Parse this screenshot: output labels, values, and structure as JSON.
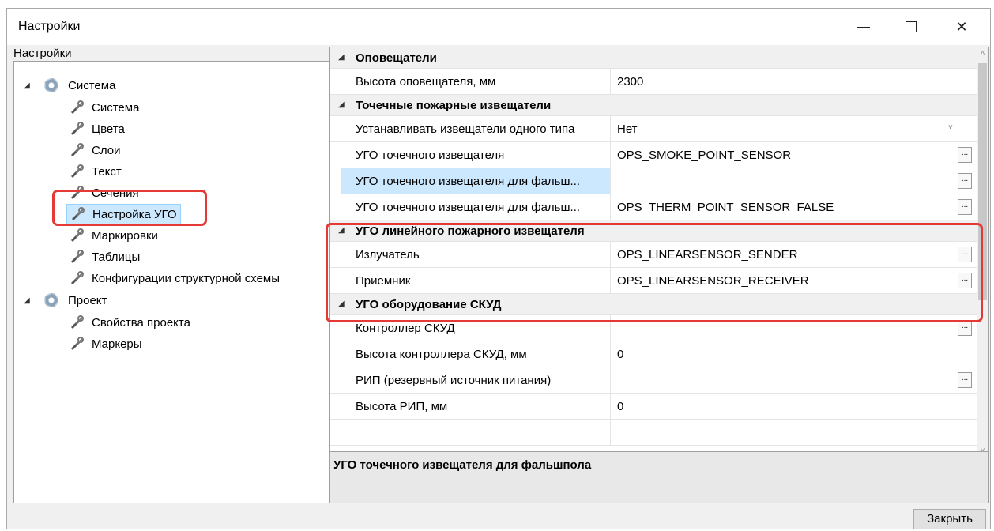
{
  "window": {
    "title": "Настройки",
    "minimize_icon": "minimize-icon",
    "maximize_icon": "maximize-icon",
    "close_icon": "close-icon"
  },
  "tree": {
    "label": "Настройки",
    "root_system": "Система",
    "system_children": [
      "Система",
      "Цвета",
      "Слои",
      "Текст",
      "Сечения",
      "Настройка УГО",
      "Маркировки",
      "Таблицы",
      "Конфигурации структурной схемы"
    ],
    "root_project": "Проект",
    "project_children": [
      "Свойства проекта",
      "Маркеры"
    ]
  },
  "grid": {
    "cat_notifiers": "Оповещатели",
    "notifier_height_name": "Высота оповещателя, мм",
    "notifier_height_value": "2300",
    "cat_point_sensors": "Точечные пожарные извещатели",
    "same_type_name": "Устанавливать извещатели одного типа",
    "same_type_value": "Нет",
    "point_ugo_name": "УГО точечного извещателя",
    "point_ugo_value": "OPS_SMOKE_POINT_SENSOR",
    "point_false_floor_name": "УГО точечного извещателя для фальш...",
    "point_false_floor_value": "",
    "point_false_floor2_name": "УГО точечного извещателя для фальш...",
    "point_false_floor2_value": "OPS_THERM_POINT_SENSOR_FALSE",
    "cat_linear": "УГО линейного пожарного извещателя",
    "emitter_name": "Излучатель",
    "emitter_value": "OPS_LINEARSENSOR_SENDER",
    "receiver_name": "Приемник",
    "receiver_value": "OPS_LINEARSENSOR_RECEIVER",
    "cat_skud": "УГО оборудование СКУД",
    "skud_controller_name": "Контроллер СКУД",
    "skud_controller_value": "",
    "skud_height_name": "Высота контроллера СКУД, мм",
    "skud_height_value": "0",
    "rip_name": "РИП (резервный источник питания)",
    "rip_value": "",
    "rip_height_name": "Высота РИП, мм",
    "rip_height_value": "0",
    "ellipsis": "..."
  },
  "description": {
    "title": "УГО точечного извещателя для фальшпола"
  },
  "buttons": {
    "close": "Закрыть"
  }
}
